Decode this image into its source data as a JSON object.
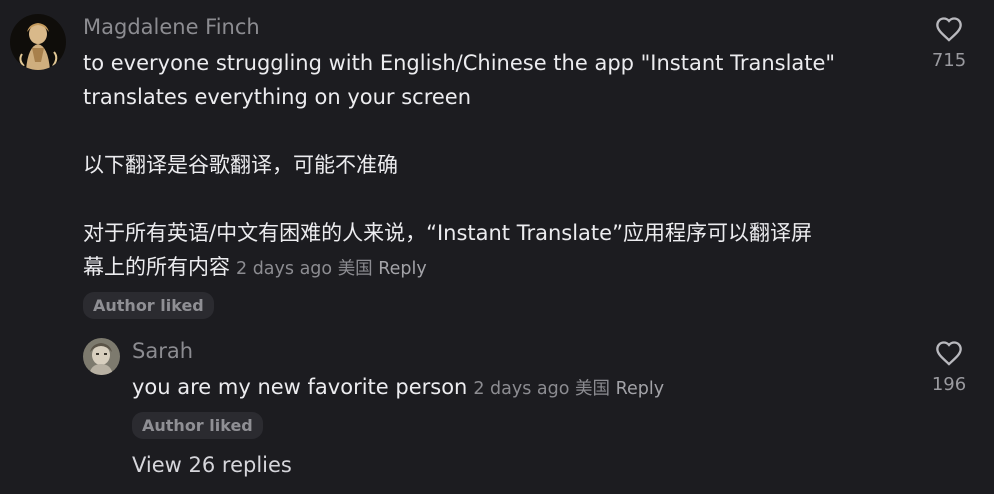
{
  "comment": {
    "username": "Magdalene Finch",
    "line1": "to everyone struggling with English/Chinese the app \"Instant Translate\"",
    "line2": "translates everything on your screen",
    "line3": "以下翻译是谷歌翻译，可能不准确",
    "line4": "对于所有英语/中文有困难的人来说，“Instant Translate”应用程序可以翻译屏",
    "line5": "幕上的所有内容",
    "timestamp": "2 days ago",
    "region": "美国",
    "reply_label": "Reply",
    "badge": "Author liked",
    "like_count": "715",
    "icons": {
      "like": "heart-outline-icon",
      "avatar": "woman-illustration-avatar"
    }
  },
  "reply": {
    "username": "Sarah",
    "text": "you are my new favorite person",
    "timestamp": "2 days ago",
    "region": "美国",
    "reply_label": "Reply",
    "badge": "Author liked",
    "like_count": "196",
    "icons": {
      "like": "heart-outline-icon",
      "avatar": "person-photo-avatar"
    }
  },
  "view_replies": "View 26 replies",
  "colors": {
    "background": "#1c1c20",
    "text": "#ececef",
    "muted": "#8c8c91",
    "badge_bg": "#2b2b30"
  }
}
